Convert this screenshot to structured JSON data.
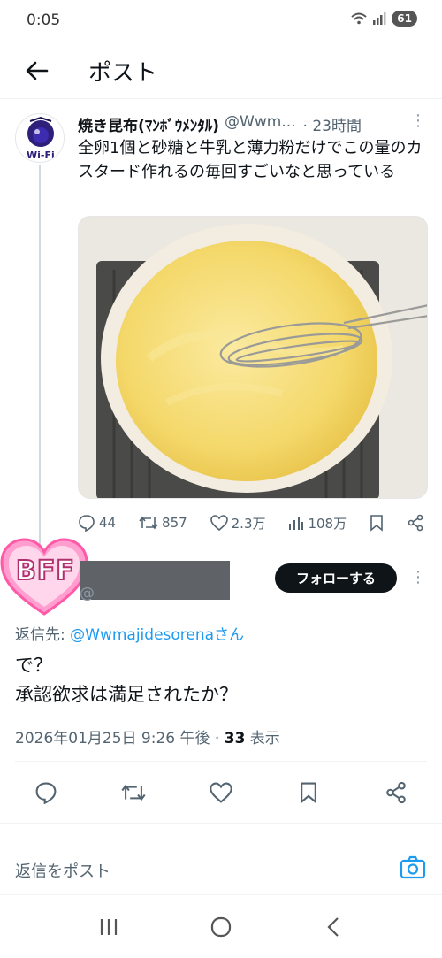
{
  "status_bar": {
    "time": "0:05",
    "battery": "61"
  },
  "header": {
    "title": "ポスト"
  },
  "tweet": {
    "avatar_text": "Wi-Fi",
    "name": "焼き昆布(ﾏﾝﾎﾞｳﾒﾝﾀﾙ)",
    "handle": "@Wwm...",
    "time": "· 23時間",
    "text": "全卵1個と砂糖と牛乳と薄力粉だけでこの量のカスタード作れるの毎回すごいなと思っている",
    "stats": {
      "replies": "44",
      "reposts": "857",
      "likes": "2.3万",
      "views": "108万"
    }
  },
  "reply": {
    "badge_text": "BFF",
    "handle_fragment": "@",
    "follow_label": "フォローする",
    "reply_to_prefix": "返信先: ",
    "reply_to_handle": "@Wwmajidesorenaさん",
    "text_line1": "で？",
    "text_line2": "承認欲求は満足されたか？",
    "timestamp": "2026年01月25日 9:26 午後 · ",
    "view_count": "33",
    "view_label": " 表示"
  },
  "compose": {
    "placeholder": "返信をポスト"
  },
  "colors": {
    "accent": "#1d9bf0",
    "text": "#0f1419",
    "muted": "#536471",
    "badge_pink": "#ff6fb5"
  }
}
